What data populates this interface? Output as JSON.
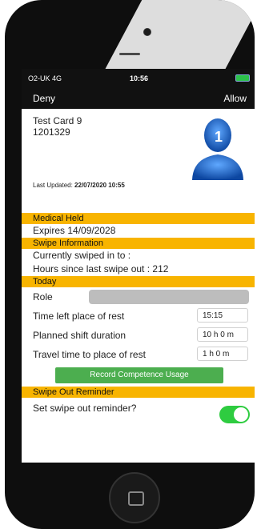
{
  "status_bar": {
    "carrier": "O2-UK 4G",
    "time": "10:56"
  },
  "nav": {
    "deny": "Deny",
    "allow": "Allow"
  },
  "card": {
    "name": "Test Card 9",
    "number": "1201329",
    "last_updated_label": "Last Updated:",
    "last_updated_value": "22/07/2020 10:55",
    "avatar_badge": "1"
  },
  "medical": {
    "header": "Medical Held",
    "expires": "Expires 14/09/2028"
  },
  "swipe": {
    "header": "Swipe Information",
    "currently": "Currently swiped in to :",
    "hours": "Hours since last swipe out : 212"
  },
  "today": {
    "header": "Today",
    "role_label": "Role",
    "time_left_label": "Time left place of rest",
    "time_left_value": "15:15",
    "planned_label": "Planned shift duration",
    "planned_value": "10 h 0 m",
    "travel_label": "Travel time to place of rest",
    "travel_value": "1 h 0 m",
    "record_button": "Record Competence Usage"
  },
  "reminder": {
    "header": "Swipe Out Reminder",
    "set_label": "Set swipe out reminder?",
    "toggle_on": true
  },
  "colors": {
    "section": "#f8b400",
    "button": "#4cae4f",
    "toggle": "#2ecc40",
    "avatar": "#1565c0"
  },
  "icons": [
    "signal-icon",
    "battery-icon",
    "avatar-icon",
    "home-button-icon"
  ]
}
